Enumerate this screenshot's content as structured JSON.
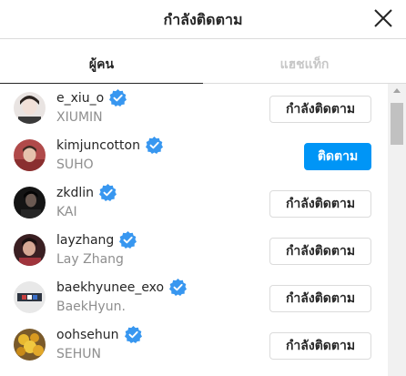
{
  "header": {
    "title": "กำลังติดตาม"
  },
  "tabs": [
    {
      "label": "ผู้คน",
      "active": true
    },
    {
      "label": "แฮชแท็ก",
      "active": false
    }
  ],
  "users": [
    {
      "username": "e_xiu_o",
      "fullname": "XIUMIN",
      "verified": true,
      "button": "กำลังติดตาม",
      "button_style": "outline"
    },
    {
      "username": "kimjuncotton",
      "fullname": "SUHO",
      "verified": true,
      "button": "ติดตาม",
      "button_style": "primary"
    },
    {
      "username": "zkdlin",
      "fullname": "KAI",
      "verified": true,
      "button": "กำลังติดตาม",
      "button_style": "outline"
    },
    {
      "username": "layzhang",
      "fullname": "Lay Zhang",
      "verified": true,
      "button": "กำลังติดตาม",
      "button_style": "outline"
    },
    {
      "username": "baekhyunee_exo",
      "fullname": "BaekHyun.",
      "verified": true,
      "button": "กำลังติดตาม",
      "button_style": "outline"
    },
    {
      "username": "oohsehun",
      "fullname": "SEHUN",
      "verified": true,
      "button": "กำลังติดตาม",
      "button_style": "outline"
    }
  ],
  "colors": {
    "primary": "#0095f6",
    "verified": "#3897f0",
    "secondary_text": "#8e8e8e",
    "border": "#dbdbdb"
  }
}
